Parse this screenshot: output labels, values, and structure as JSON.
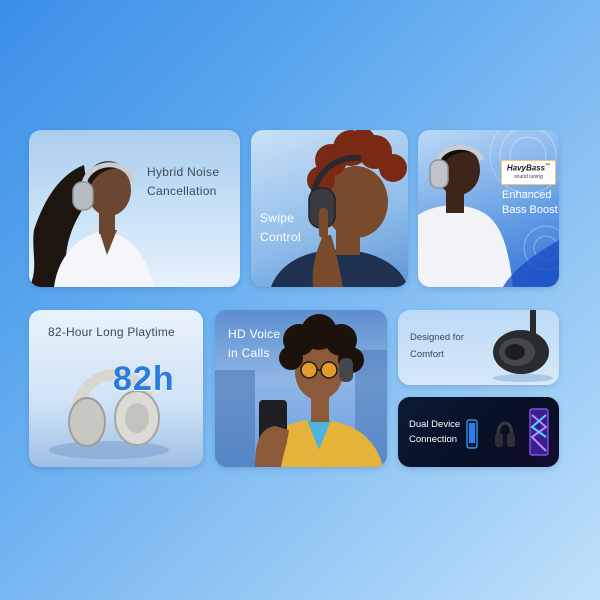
{
  "cards": {
    "noise": {
      "line1": "Hybrid Noise",
      "line2": "Cancellation"
    },
    "swipe": {
      "line1": "Swipe",
      "line2": "Control"
    },
    "bass": {
      "badge_brand": "HavyBass",
      "badge_tm": "™",
      "badge_sub": "sound tuning",
      "line1": "Enhanced",
      "line2": "Bass Boost"
    },
    "playtime": {
      "title": "82-Hour Long Playtime",
      "big_number": "82h"
    },
    "voice": {
      "line1": "HD Voice",
      "line2": "in Calls"
    },
    "comfort": {
      "line1": "Designed for",
      "line2": "Comfort"
    },
    "dual": {
      "line1": "Dual Device",
      "line2": "Connection"
    }
  },
  "colors": {
    "text_dark": "#3a4a5e",
    "text_white": "#ffffff",
    "blue_accent": "#2a7be0",
    "badge_gold": "#f2c76b"
  },
  "icons": [
    "headphones-icon",
    "smartphone-icon",
    "laptop-icon"
  ]
}
